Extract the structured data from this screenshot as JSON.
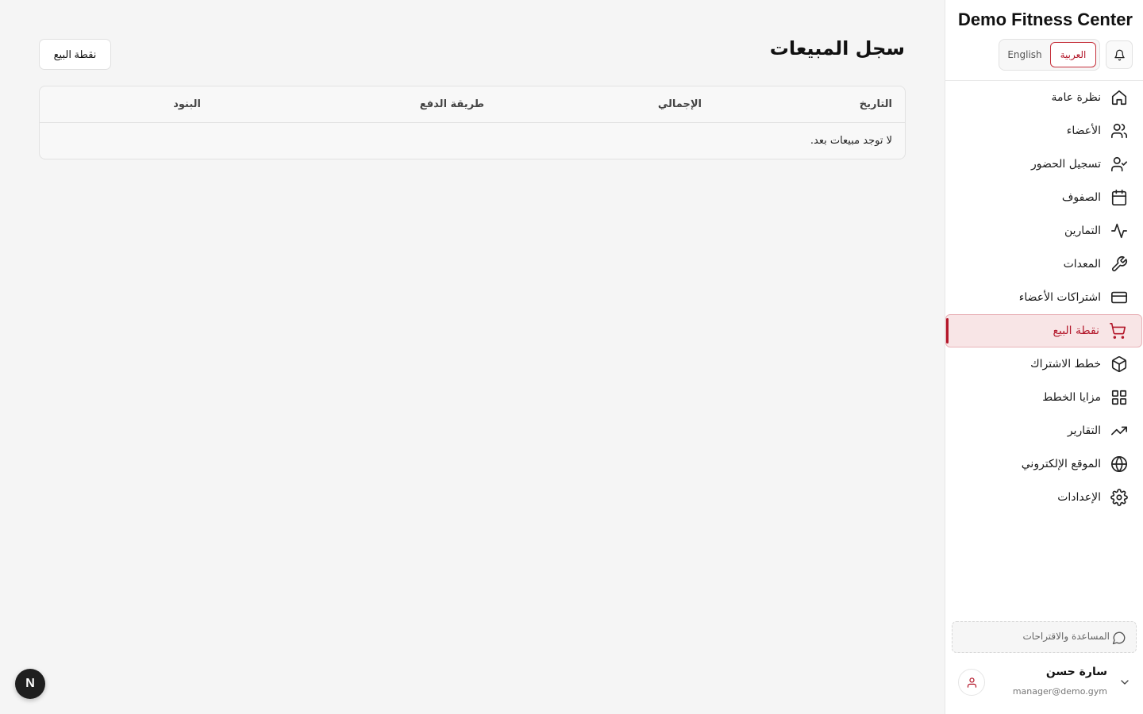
{
  "sidebar": {
    "brand": "Demo Fitness Center",
    "languages": {
      "english": "English",
      "arabic": "العربية",
      "active": "arabic"
    },
    "items": [
      {
        "label": "نظرة عامة",
        "icon": "home-icon"
      },
      {
        "label": "الأعضاء",
        "icon": "users-icon"
      },
      {
        "label": "تسجيل الحضور",
        "icon": "user-check-icon"
      },
      {
        "label": "الصفوف",
        "icon": "calendar-icon"
      },
      {
        "label": "التمارين",
        "icon": "activity-icon"
      },
      {
        "label": "المعدات",
        "icon": "wrench-icon"
      },
      {
        "label": "اشتراكات الأعضاء",
        "icon": "credit-card-icon"
      },
      {
        "label": "نقطة البيع",
        "icon": "shopping-cart-icon",
        "active": true
      },
      {
        "label": "خطط الاشتراك",
        "icon": "package-icon"
      },
      {
        "label": "مزايا الخطط",
        "icon": "grid-icon"
      },
      {
        "label": "التقارير",
        "icon": "trending-up-icon"
      },
      {
        "label": "الموقع الإلكتروني",
        "icon": "globe-icon"
      },
      {
        "label": "الإعدادات",
        "icon": "settings-icon"
      }
    ],
    "help": "المساعدة والاقتراحات",
    "user": {
      "name": "سارة حسن",
      "email": "manager@demo.gym"
    }
  },
  "main": {
    "title": "سجل المبيعات",
    "pos_button": "نقطة البيع",
    "table": {
      "columns": {
        "date": "التاريخ",
        "total": "الإجمالي",
        "payment": "طريقة الدفع",
        "items": "البنود"
      },
      "empty": "لا توجد مبيعات بعد."
    }
  },
  "dev_badge": "N",
  "colors": {
    "accent": "#b3172a",
    "active_bg": "#f8e5e6"
  }
}
